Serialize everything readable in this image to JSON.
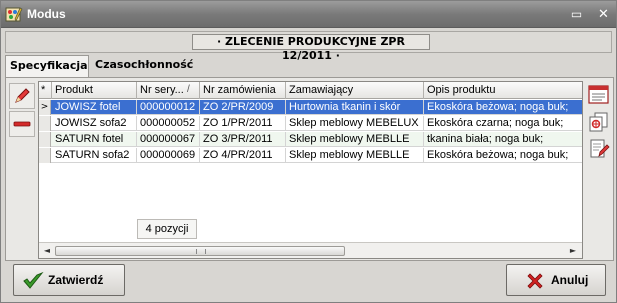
{
  "window": {
    "title": "Modus",
    "min_glyph": "▭",
    "close_glyph": "✕"
  },
  "caption": "· ZLECENIE PRODUKCYJNE ZPR 12/2011 ·",
  "tabs": [
    {
      "label": "Specyfikacja",
      "active": true
    },
    {
      "label": "Czasochłonność",
      "active": false
    }
  ],
  "grid": {
    "indicator_header": "*",
    "columns": [
      "Produkt",
      "Nr sery...",
      "Nr zamówienia",
      "Zamawiający",
      "Opis produktu"
    ],
    "sort_glyph": "/",
    "rows": [
      {
        "indicator": ">",
        "produkt": "JOWISZ fotel",
        "nr_serii": "000000012",
        "nr_zam": "ZO 2/PR/2009",
        "zamawiajacy": "Hurtownia tkanin i skór",
        "opis": "Ekoskóra beżowa; noga buk;",
        "selected": true
      },
      {
        "indicator": "",
        "produkt": "JOWISZ sofa2",
        "nr_serii": "000000052",
        "nr_zam": "ZO 1/PR/2011",
        "zamawiajacy": "Sklep meblowy MEBELUX",
        "opis": "Ekoskóra czarna; noga buk;"
      },
      {
        "indicator": "",
        "produkt": "SATURN fotel",
        "nr_serii": "000000067",
        "nr_zam": "ZO 3/PR/2011",
        "zamawiajacy": "Sklep meblowy MEBLLE",
        "opis": "tkanina biała; noga buk;"
      },
      {
        "indicator": "",
        "produkt": "SATURN sofa2",
        "nr_serii": "000000069",
        "nr_zam": "ZO 4/PR/2011",
        "zamawiajacy": "Sklep meblowy MEBLLE",
        "opis": "Ekoskóra beżowa; noga buk;"
      }
    ],
    "footer_count": "4 pozycji",
    "scroll_left": "◄",
    "scroll_right": "►"
  },
  "icons": {
    "left_toolbar": [
      "pencil-edit-icon",
      "remove-minus-icon"
    ],
    "right_toolbar": [
      "form-view-icon",
      "copy-documents-icon",
      "edit-document-icon"
    ]
  },
  "buttons": {
    "confirm": "Zatwierdź",
    "cancel": "Anuluj"
  },
  "colors": {
    "selection": "#3b6fd0",
    "alt_row": "#f0f7ef",
    "titlebar": "#7a7a7a",
    "cancel_icon": "#d22222",
    "confirm_icon": "#3a9a2a"
  }
}
